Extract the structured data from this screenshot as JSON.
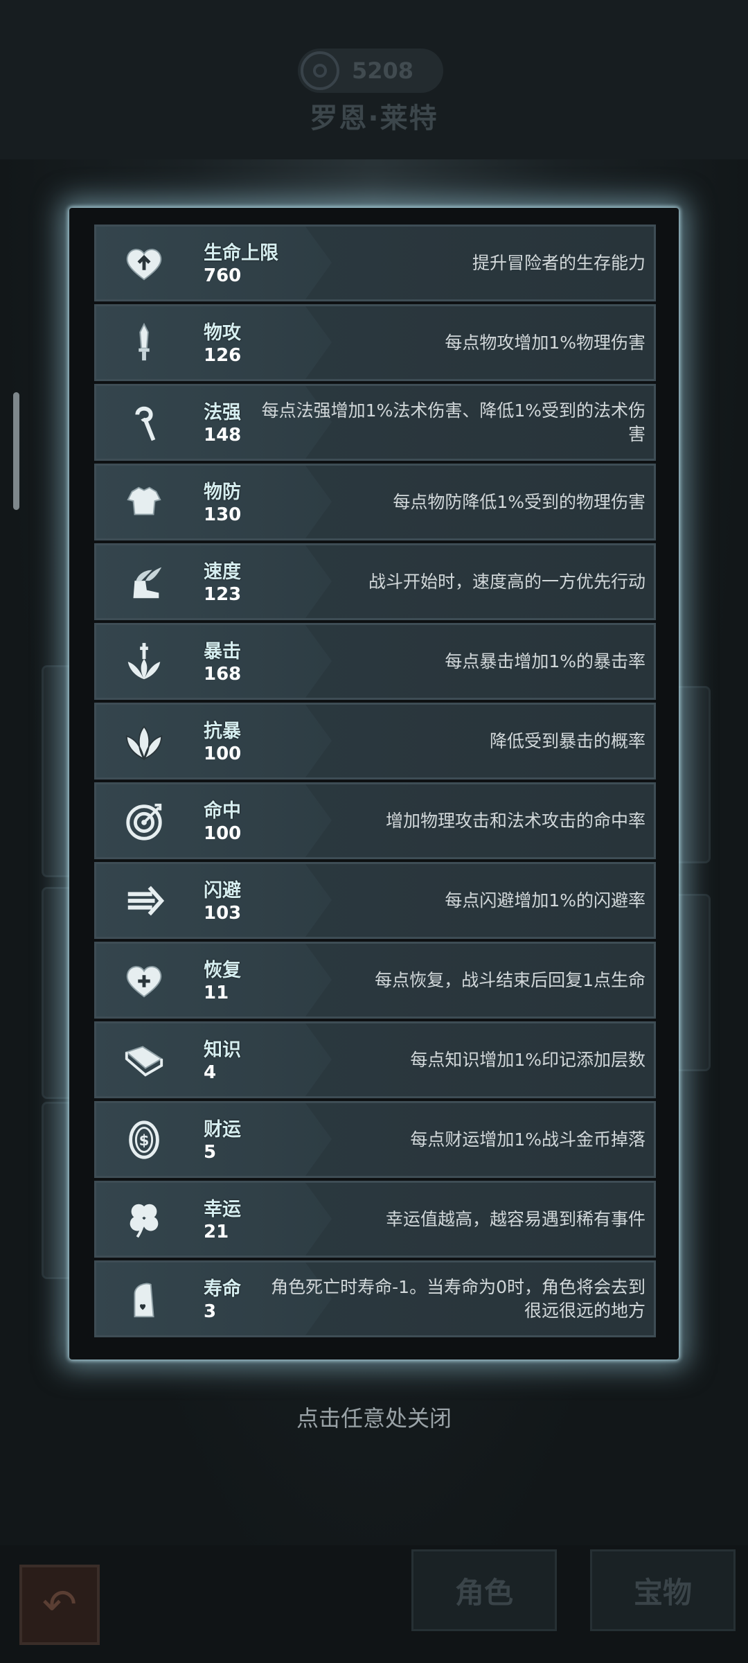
{
  "header": {
    "power_value": "5208",
    "character_name": "罗恩·莱特"
  },
  "stats": [
    {
      "icon": "heart-up-icon",
      "name": "生命上限",
      "value": "760",
      "desc": "提升冒险者的生存能力"
    },
    {
      "icon": "sword-icon",
      "name": "物攻",
      "value": "126",
      "desc": "每点物攻增加1%物理伤害"
    },
    {
      "icon": "staff-icon",
      "name": "法强",
      "value": "148",
      "desc": "每点法强增加1%法术伤害、降低1%受到的法术伤害"
    },
    {
      "icon": "armor-icon",
      "name": "物防",
      "value": "130",
      "desc": "每点物防降低1%受到的物理伤害"
    },
    {
      "icon": "winged-boot-icon",
      "name": "速度",
      "value": "123",
      "desc": "战斗开始时，速度高的一方优先行动"
    },
    {
      "icon": "crit-icon",
      "name": "暴击",
      "value": "168",
      "desc": "每点暴击增加1%的暴击率"
    },
    {
      "icon": "crit-resist-icon",
      "name": "抗暴",
      "value": "100",
      "desc": "降低受到暴击的概率"
    },
    {
      "icon": "target-icon",
      "name": "命中",
      "value": "100",
      "desc": "增加物理攻击和法术攻击的命中率"
    },
    {
      "icon": "dodge-icon",
      "name": "闪避",
      "value": "103",
      "desc": "每点闪避增加1%的闪避率"
    },
    {
      "icon": "heart-plus-icon",
      "name": "恢复",
      "value": "11",
      "desc": "每点恢复，战斗结束后回复1点生命"
    },
    {
      "icon": "book-icon",
      "name": "知识",
      "value": "4",
      "desc": "每点知识增加1%印记添加层数"
    },
    {
      "icon": "coin-icon",
      "name": "财运",
      "value": "5",
      "desc": "每点财运增加1%战斗金币掉落"
    },
    {
      "icon": "clover-icon",
      "name": "幸运",
      "value": "21",
      "desc": "幸运值越高，越容易遇到稀有事件"
    },
    {
      "icon": "tombstone-icon",
      "name": "寿命",
      "value": "3",
      "desc": "角色死亡时寿命-1。当寿命为0时，角色将会去到很远很远的地方"
    }
  ],
  "close_hint": "点击任意处关闭",
  "bottom_tabs": {
    "character": "角色",
    "treasure": "宝物"
  },
  "colors": {
    "panel_glow": "#a0d2e1",
    "row_bg": "#2c3a41",
    "name_color": "#d6eef0"
  }
}
